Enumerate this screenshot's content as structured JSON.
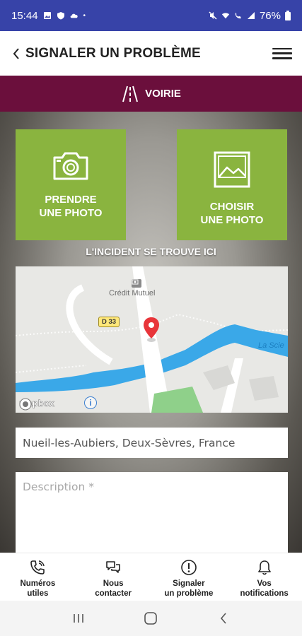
{
  "status_bar": {
    "time": "15:44",
    "battery": "76%"
  },
  "header": {
    "title": "SIGNALER UN PROBLÈME"
  },
  "category": {
    "label": "VOIRIE"
  },
  "actions": {
    "take_photo": "PRENDRE\nUNE PHOTO",
    "choose_photo": "CHOISIR\nUNE PHOTO"
  },
  "incident_label": "L'INCIDENT SE TROUVE ICI",
  "map": {
    "poi_label": "Crédit Mutuel",
    "road_shield": "D 33",
    "river_label": "La Scie",
    "attribution": "mapbox"
  },
  "form": {
    "location_value": "Nueil-les-Aubiers, Deux-Sèvres, France",
    "description_placeholder": "Description *"
  },
  "bottom_nav": [
    {
      "label": "Numéros\nutiles",
      "icon": "phone-icon"
    },
    {
      "label": "Nous\ncontacter",
      "icon": "chat-icon"
    },
    {
      "label": "Signaler\nun problème",
      "icon": "alert-icon"
    },
    {
      "label": "Vos\nnotifications",
      "icon": "bell-icon"
    }
  ],
  "colors": {
    "status_bar": "#3743a8",
    "category_bar": "#6b0f3c",
    "action_green": "#8ab43f",
    "map_water": "#3aa8e8",
    "map_pin": "#e8353a"
  }
}
